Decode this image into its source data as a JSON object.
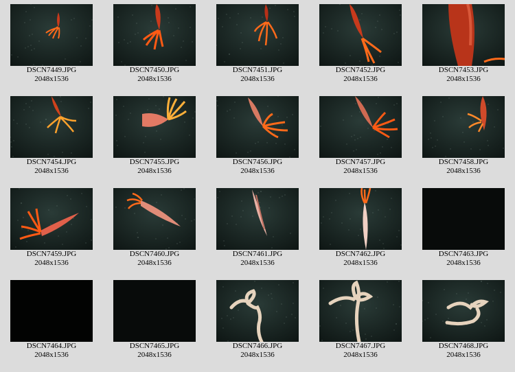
{
  "colors": {
    "background": "#dcdcdc",
    "water_dark": "#0f1715",
    "water_light": "#2a3b37",
    "squid": "#d8401c",
    "arms": "#ff6a1a",
    "string": "#e6d3bd"
  },
  "thumbnails": [
    {
      "filename": "DSCN7449.JPG",
      "dimensions": "2048x1536",
      "subject": "squid",
      "brightness": "normal"
    },
    {
      "filename": "DSCN7450.JPG",
      "dimensions": "2048x1536",
      "subject": "squid",
      "brightness": "normal"
    },
    {
      "filename": "DSCN7451.JPG",
      "dimensions": "2048x1536",
      "subject": "squid",
      "brightness": "normal"
    },
    {
      "filename": "DSCN7452.JPG",
      "dimensions": "2048x1536",
      "subject": "squid",
      "brightness": "normal"
    },
    {
      "filename": "DSCN7453.JPG",
      "dimensions": "2048x1536",
      "subject": "squid-closeup",
      "brightness": "normal"
    },
    {
      "filename": "DSCN7454.JPG",
      "dimensions": "2048x1536",
      "subject": "squid",
      "brightness": "normal"
    },
    {
      "filename": "DSCN7455.JPG",
      "dimensions": "2048x1536",
      "subject": "squid",
      "brightness": "normal"
    },
    {
      "filename": "DSCN7456.JPG",
      "dimensions": "2048x1536",
      "subject": "squid",
      "brightness": "normal"
    },
    {
      "filename": "DSCN7457.JPG",
      "dimensions": "2048x1536",
      "subject": "squid",
      "brightness": "normal"
    },
    {
      "filename": "DSCN7458.JPG",
      "dimensions": "2048x1536",
      "subject": "squid",
      "brightness": "normal"
    },
    {
      "filename": "DSCN7459.JPG",
      "dimensions": "2048x1536",
      "subject": "squid",
      "brightness": "normal"
    },
    {
      "filename": "DSCN7460.JPG",
      "dimensions": "2048x1536",
      "subject": "squid",
      "brightness": "normal"
    },
    {
      "filename": "DSCN7461.JPG",
      "dimensions": "2048x1536",
      "subject": "squid-pale",
      "brightness": "normal"
    },
    {
      "filename": "DSCN7462.JPG",
      "dimensions": "2048x1536",
      "subject": "squid-pale",
      "brightness": "normal"
    },
    {
      "filename": "DSCN7463.JPG",
      "dimensions": "2048x1536",
      "subject": "none",
      "brightness": "dark"
    },
    {
      "filename": "DSCN7464.JPG",
      "dimensions": "2048x1536",
      "subject": "none",
      "brightness": "black"
    },
    {
      "filename": "DSCN7465.JPG",
      "dimensions": "2048x1536",
      "subject": "none",
      "brightness": "dark"
    },
    {
      "filename": "DSCN7466.JPG",
      "dimensions": "2048x1536",
      "subject": "string",
      "brightness": "normal"
    },
    {
      "filename": "DSCN7467.JPG",
      "dimensions": "2048x1536",
      "subject": "string",
      "brightness": "normal"
    },
    {
      "filename": "DSCN7468.JPG",
      "dimensions": "2048x1536",
      "subject": "string",
      "brightness": "normal"
    }
  ]
}
